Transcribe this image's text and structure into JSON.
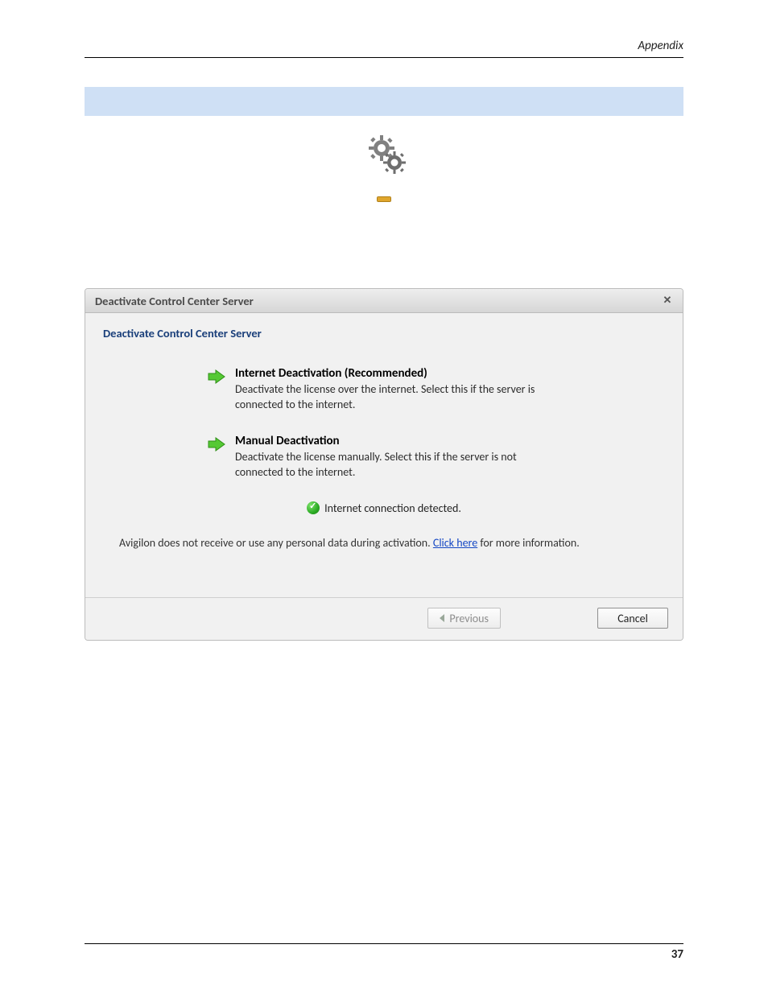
{
  "header": {
    "section": "Appendix"
  },
  "dialog": {
    "title": "Deactivate Control Center Server",
    "heading": "Deactivate Control Center Server",
    "options": [
      {
        "label": "Internet Deactivation (Recommended)",
        "desc": "Deactivate the license over the internet.  Select this if the server is connected to the internet."
      },
      {
        "label": "Manual Deactivation",
        "desc": "Deactivate the license manually.  Select this if the server is not connected to the internet."
      }
    ],
    "status": "Internet connection detected.",
    "footnote_pre": "Avigilon does not receive or use any personal data during activation. ",
    "footnote_link": "Click here",
    "footnote_post": " for more information.",
    "buttons": {
      "previous": "Previous",
      "cancel": "Cancel"
    }
  },
  "page_number": "37"
}
